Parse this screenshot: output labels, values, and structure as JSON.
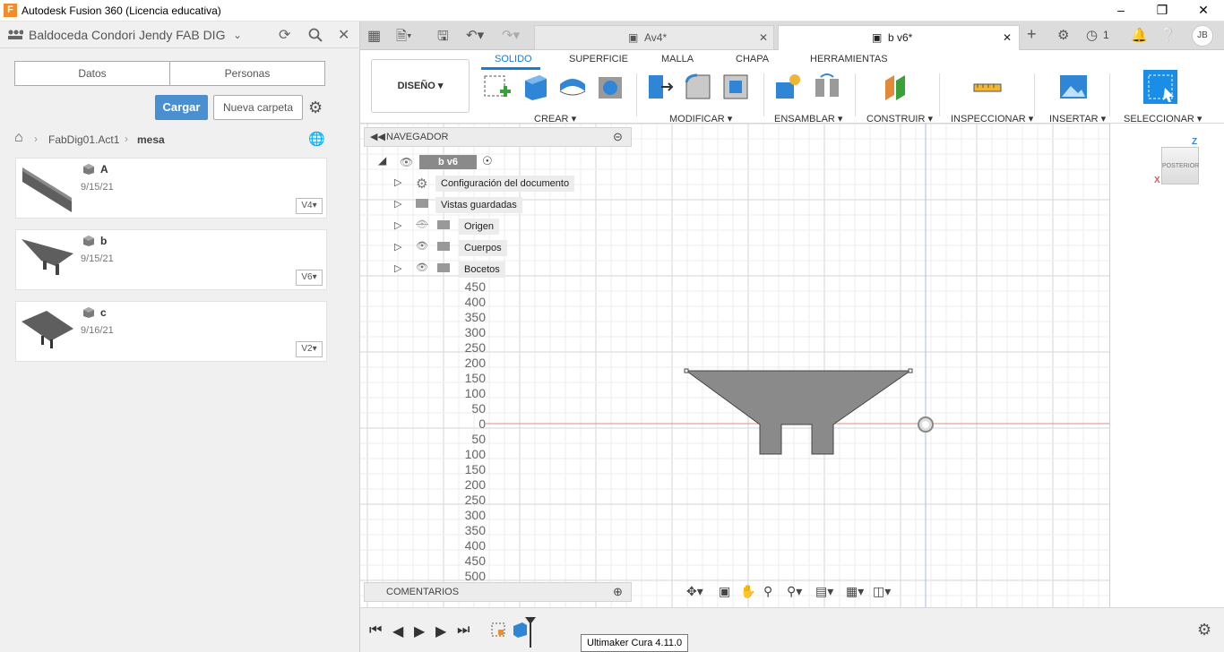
{
  "window": {
    "title": "Autodesk Fusion 360 (Licencia educativa)",
    "logo": "F"
  },
  "data_panel": {
    "team": "Baldoceda Condori Jendy FAB DIG",
    "tabs": [
      "Datos",
      "Personas"
    ],
    "upload_label": "Cargar",
    "new_folder_label": "Nueva carpeta",
    "breadcrumb": {
      "project": "FabDig01.Act1",
      "folder": "mesa"
    },
    "files": [
      {
        "name": "A",
        "date": "9/15/21",
        "version": "V4"
      },
      {
        "name": "b",
        "date": "9/15/21",
        "version": "V6"
      },
      {
        "name": "c",
        "date": "9/16/21",
        "version": "V2"
      }
    ]
  },
  "doc_tabs": [
    {
      "label": "Av4*"
    },
    {
      "label": "b v6*"
    }
  ],
  "topbar": {
    "jobs_count": "1",
    "user_initials": "JB"
  },
  "ribbon": {
    "workspace": "DISEÑO",
    "tabs": [
      "SOLIDO",
      "SUPERFICIE",
      "MALLA",
      "CHAPA",
      "HERRAMIENTAS"
    ],
    "active_tab": "SOLIDO",
    "groups": [
      "CREAR",
      "MODIFICAR",
      "ENSAMBLAR",
      "CONSTRUIR",
      "INSPECCIONAR",
      "INSERTAR",
      "SELECCIONAR"
    ]
  },
  "navigator": {
    "title": "NAVEGADOR",
    "root": "b v6",
    "items": [
      "Configuración del documento",
      "Vistas guardadas",
      "Origen",
      "Cuerpos",
      "Bocetos"
    ]
  },
  "comments_label": "COMENTARIOS",
  "ruler": {
    "ticks_top": [
      "450",
      "400",
      "350",
      "300",
      "250",
      "200",
      "150",
      "100",
      "50",
      "0"
    ],
    "ticks_bottom": [
      "50",
      "100",
      "150",
      "200",
      "250",
      "300",
      "350",
      "400",
      "450",
      "500"
    ]
  },
  "viewcube": {
    "label": "POSTERIOR",
    "z_axis": "Z",
    "x_axis": "X"
  },
  "tooltip": "Ultimaker Cura 4.11.0",
  "colors": {
    "accent": "#1a7bd6",
    "upload_button": "#4a8fd0",
    "part_fill": "#8a8a8a",
    "origin_axis": "#e08a8a"
  }
}
